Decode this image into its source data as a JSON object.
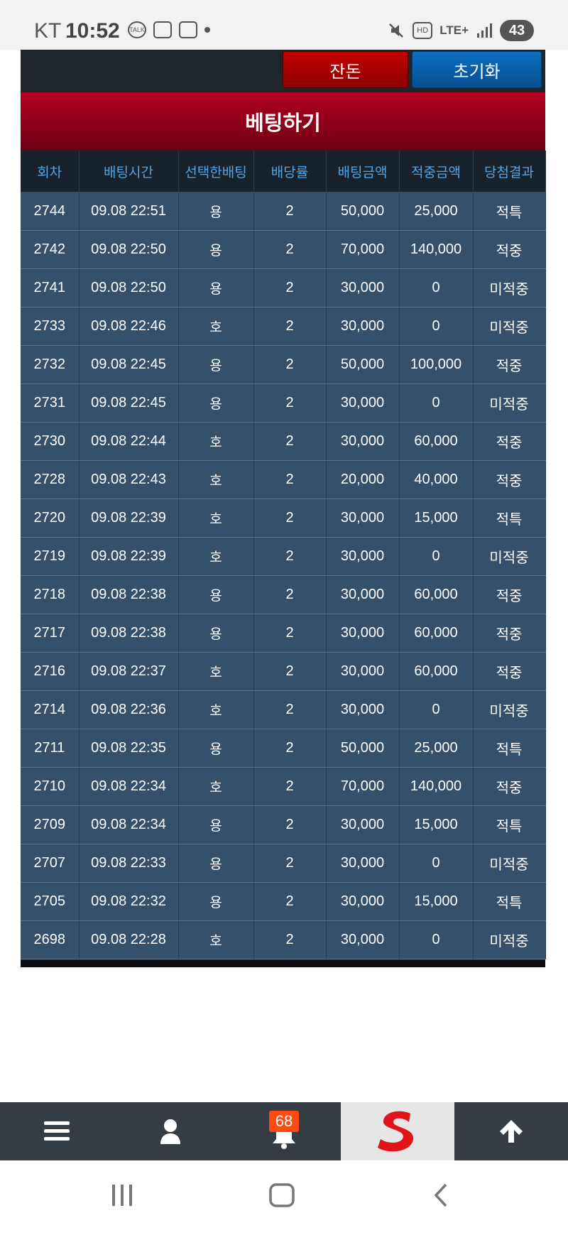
{
  "status_bar": {
    "carrier": "KT",
    "time": "10:52",
    "talk_label": "TALK",
    "network": "LTE+",
    "hd_label": "HD",
    "battery": "43"
  },
  "toolbar": {
    "balance_label": "잔돈",
    "reset_label": "초기화"
  },
  "page": {
    "title": "베팅하기"
  },
  "table": {
    "headers": [
      "회차",
      "배팅시간",
      "선택한배팅",
      "배당률",
      "배팅금액",
      "적중금액",
      "당첨결과"
    ],
    "rows": [
      {
        "round": "2744",
        "time": "09.08 22:51",
        "pick": "용",
        "odds": "2",
        "amount": "50,000",
        "payout": "25,000",
        "result": "적특",
        "result_type": "special"
      },
      {
        "round": "2742",
        "time": "09.08 22:50",
        "pick": "용",
        "odds": "2",
        "amount": "70,000",
        "payout": "140,000",
        "result": "적중",
        "result_type": "hit"
      },
      {
        "round": "2741",
        "time": "09.08 22:50",
        "pick": "용",
        "odds": "2",
        "amount": "30,000",
        "payout": "0",
        "result": "미적중",
        "result_type": "lose"
      },
      {
        "round": "2733",
        "time": "09.08 22:46",
        "pick": "호",
        "odds": "2",
        "amount": "30,000",
        "payout": "0",
        "result": "미적중",
        "result_type": "lose"
      },
      {
        "round": "2732",
        "time": "09.08 22:45",
        "pick": "용",
        "odds": "2",
        "amount": "50,000",
        "payout": "100,000",
        "result": "적중",
        "result_type": "hit"
      },
      {
        "round": "2731",
        "time": "09.08 22:45",
        "pick": "용",
        "odds": "2",
        "amount": "30,000",
        "payout": "0",
        "result": "미적중",
        "result_type": "lose"
      },
      {
        "round": "2730",
        "time": "09.08 22:44",
        "pick": "호",
        "odds": "2",
        "amount": "30,000",
        "payout": "60,000",
        "result": "적중",
        "result_type": "hit"
      },
      {
        "round": "2728",
        "time": "09.08 22:43",
        "pick": "호",
        "odds": "2",
        "amount": "20,000",
        "payout": "40,000",
        "result": "적중",
        "result_type": "hit"
      },
      {
        "round": "2720",
        "time": "09.08 22:39",
        "pick": "호",
        "odds": "2",
        "amount": "30,000",
        "payout": "15,000",
        "result": "적특",
        "result_type": "special"
      },
      {
        "round": "2719",
        "time": "09.08 22:39",
        "pick": "호",
        "odds": "2",
        "amount": "30,000",
        "payout": "0",
        "result": "미적중",
        "result_type": "lose"
      },
      {
        "round": "2718",
        "time": "09.08 22:38",
        "pick": "용",
        "odds": "2",
        "amount": "30,000",
        "payout": "60,000",
        "result": "적중",
        "result_type": "hit"
      },
      {
        "round": "2717",
        "time": "09.08 22:38",
        "pick": "용",
        "odds": "2",
        "amount": "30,000",
        "payout": "60,000",
        "result": "적중",
        "result_type": "hit"
      },
      {
        "round": "2716",
        "time": "09.08 22:37",
        "pick": "호",
        "odds": "2",
        "amount": "30,000",
        "payout": "60,000",
        "result": "적중",
        "result_type": "hit"
      },
      {
        "round": "2714",
        "time": "09.08 22:36",
        "pick": "호",
        "odds": "2",
        "amount": "30,000",
        "payout": "0",
        "result": "미적중",
        "result_type": "lose"
      },
      {
        "round": "2711",
        "time": "09.08 22:35",
        "pick": "용",
        "odds": "2",
        "amount": "50,000",
        "payout": "25,000",
        "result": "적특",
        "result_type": "special"
      },
      {
        "round": "2710",
        "time": "09.08 22:34",
        "pick": "호",
        "odds": "2",
        "amount": "70,000",
        "payout": "140,000",
        "result": "적중",
        "result_type": "hit"
      },
      {
        "round": "2709",
        "time": "09.08 22:34",
        "pick": "용",
        "odds": "2",
        "amount": "30,000",
        "payout": "15,000",
        "result": "적특",
        "result_type": "special"
      },
      {
        "round": "2707",
        "time": "09.08 22:33",
        "pick": "용",
        "odds": "2",
        "amount": "30,000",
        "payout": "0",
        "result": "미적중",
        "result_type": "lose"
      },
      {
        "round": "2705",
        "time": "09.08 22:32",
        "pick": "용",
        "odds": "2",
        "amount": "30,000",
        "payout": "15,000",
        "result": "적특",
        "result_type": "special"
      },
      {
        "round": "2698",
        "time": "09.08 22:28",
        "pick": "호",
        "odds": "2",
        "amount": "30,000",
        "payout": "0",
        "result": "미적중",
        "result_type": "lose"
      }
    ]
  },
  "bottom_nav": {
    "items": [
      {
        "icon": "menu-icon"
      },
      {
        "icon": "user-icon"
      },
      {
        "icon": "bell-icon",
        "badge": "68"
      },
      {
        "icon": "logo-s-icon"
      },
      {
        "icon": "arrow-up-icon"
      }
    ]
  },
  "colors": {
    "hit": "#2a8a2a",
    "lose": "#c21313",
    "special": "#e8b21a",
    "header_text": "#4fa6e6",
    "title_bg": "#9b001c",
    "reset_btn": "#0a6fc2",
    "balance_btn": "#c40000"
  }
}
